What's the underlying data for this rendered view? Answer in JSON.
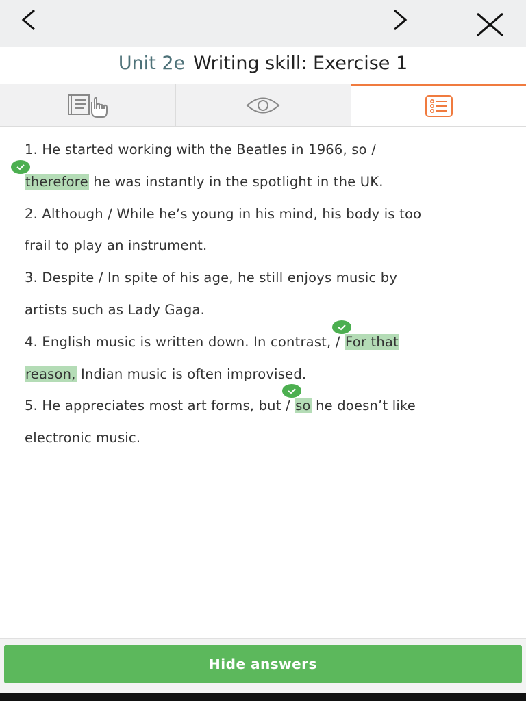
{
  "nav": {
    "back_icon": "chevron-left-icon",
    "forward_icon": "chevron-right-icon",
    "close_icon": "close-icon"
  },
  "header": {
    "unit": "Unit 2e",
    "exercise_title": "Writing skill: Exercise 1"
  },
  "tabs": [
    {
      "name": "instructions",
      "icon": "reading-pointer-icon",
      "active": false
    },
    {
      "name": "preview",
      "icon": "eye-icon",
      "active": false
    },
    {
      "name": "questions",
      "icon": "list-icon",
      "active": true
    }
  ],
  "questions": [
    {
      "before": "1. He started working with the Beatles in 1966, so /",
      "answer": "therefore",
      "after": "he was instantly in the spotlight in the UK."
    },
    {
      "line1": "2. Although / While he’s young in his mind, his body is too",
      "line2": "frail to play an instrument."
    },
    {
      "line1": "3. Despite / In spite of his age, he still enjoys music by",
      "line2": "artists such as Lady Gaga."
    },
    {
      "before": "4. English music is written down. In contrast, /",
      "answer_part1": "For that",
      "answer_part2": "reason,",
      "after": "Indian music is often improvised."
    },
    {
      "before": "5. He appreciates most art forms, but /",
      "answer": "so",
      "after": "he doesn’t like",
      "line2": "electronic music."
    }
  ],
  "footer": {
    "hide_answers_label": "Hide answers"
  },
  "colors": {
    "accent": "#f07b3f",
    "correct_highlight": "#b4dcb6",
    "check_green": "#4caf50",
    "button_green": "#5cb85c"
  }
}
